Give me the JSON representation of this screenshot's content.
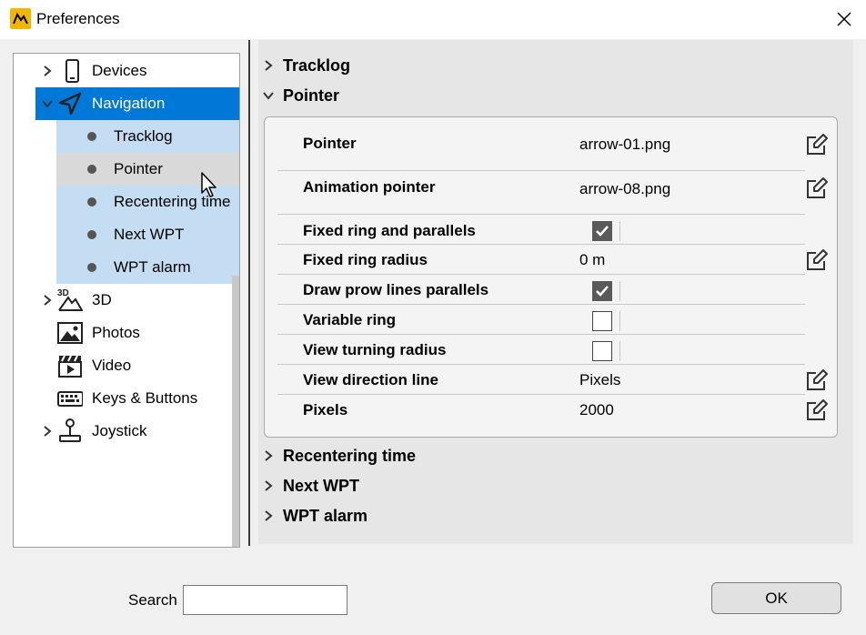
{
  "window": {
    "title": "Preferences"
  },
  "tree": {
    "items": [
      {
        "label": "Devices",
        "icon": "phone-icon",
        "expandable": true
      },
      {
        "label": "Navigation",
        "icon": "navigation-arrow-icon",
        "expanded": true,
        "selected": true,
        "children": [
          {
            "label": "Tracklog"
          },
          {
            "label": "Pointer",
            "hovered": true
          },
          {
            "label": "Recentering time"
          },
          {
            "label": "Next WPT"
          },
          {
            "label": "WPT alarm"
          }
        ]
      },
      {
        "label": "3D",
        "icon": "3d-mountain-icon",
        "expandable": true
      },
      {
        "label": "Photos",
        "icon": "photo-icon"
      },
      {
        "label": "Video",
        "icon": "video-clapper-icon"
      },
      {
        "label": "Keys & Buttons",
        "icon": "keyboard-icon"
      },
      {
        "label": "Joystick",
        "icon": "joystick-icon",
        "expandable": true
      }
    ]
  },
  "sections": {
    "tracklog": "Tracklog",
    "pointer": "Pointer",
    "recentering": "Recentering time",
    "next_wpt": "Next WPT",
    "wpt_alarm": "WPT alarm"
  },
  "pointer_props": [
    {
      "name": "Pointer",
      "value": "arrow-01.png",
      "editable": true
    },
    {
      "name": "Animation pointer",
      "value": "arrow-08.png",
      "editable": true
    },
    {
      "name": "Fixed ring and parallels",
      "checked": true
    },
    {
      "name": "Fixed ring radius",
      "value": "0 m",
      "editable": true
    },
    {
      "name": "Draw prow lines parallels",
      "checked": true
    },
    {
      "name": "Variable ring",
      "checked": false
    },
    {
      "name": "View turning radius",
      "checked": false
    },
    {
      "name": "View direction line",
      "value": "Pixels",
      "editable": true
    },
    {
      "name": "Pixels",
      "value": "2000",
      "editable": true
    }
  ],
  "footer": {
    "search_label": "Search",
    "search_value": "",
    "ok_label": "OK"
  },
  "colors": {
    "selection": "#0078d7",
    "selection_light": "#c4ddf2",
    "accent_icon": "#f2b600"
  }
}
